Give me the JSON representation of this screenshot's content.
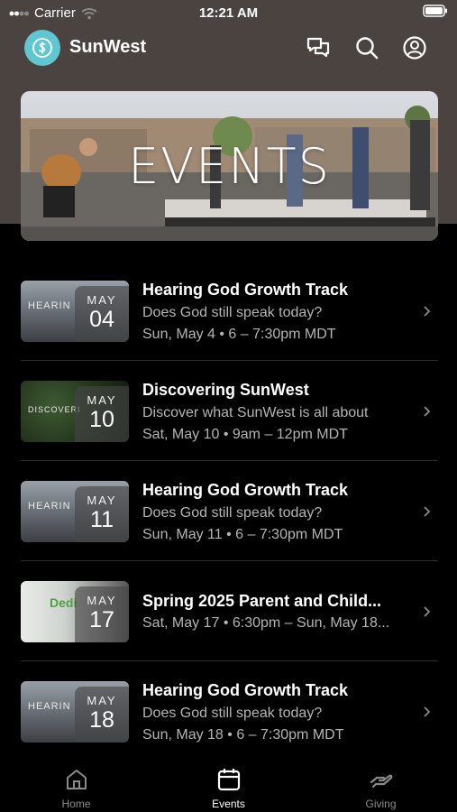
{
  "status_bar": {
    "carrier": "Carrier",
    "time": "12:21 AM"
  },
  "header": {
    "app_name": "SunWest"
  },
  "hero": {
    "title": "EVENTS"
  },
  "events": [
    {
      "month": "MAY",
      "day": "04",
      "title": "Hearing God Growth Track",
      "line1": "Does God still speak today?",
      "line2": "Sun, May 4 • 6 – 7:30pm MDT",
      "thumb_text": "HEARIN"
    },
    {
      "month": "MAY",
      "day": "10",
      "title": "Discovering SunWest",
      "line1": "Discover what SunWest is all about",
      "line2": "Sat, May 10 • 9am – 12pm MDT",
      "thumb_text": "DISCOVERI"
    },
    {
      "month": "MAY",
      "day": "11",
      "title": "Hearing God Growth Track",
      "line1": "Does God still speak today?",
      "line2": "Sun, May 11 • 6 – 7:30pm MDT",
      "thumb_text": "HEARIN"
    },
    {
      "month": "MAY",
      "day": "17",
      "title": "Spring 2025 Parent and Child...",
      "line1": "Sat, May 17 • 6:30pm – Sun, May 18...",
      "line2": "",
      "thumb_text": "Dedi"
    },
    {
      "month": "MAY",
      "day": "18",
      "title": "Hearing God Growth Track",
      "line1": "Does God still speak today?",
      "line2": "Sun, May 18 • 6 – 7:30pm MDT",
      "thumb_text": "HEARIN"
    }
  ],
  "tabs": [
    {
      "label": "Home",
      "icon": "home-icon",
      "active": false
    },
    {
      "label": "Events",
      "icon": "calendar-icon",
      "active": true
    },
    {
      "label": "Giving",
      "icon": "giving-hand-icon",
      "active": false
    }
  ],
  "colors": {
    "logo": "#5fc7cf",
    "header_bg": "#4a4340",
    "background": "#000000",
    "muted_text": "#b4b4b4",
    "inactive_tab": "#8a8a8a"
  }
}
